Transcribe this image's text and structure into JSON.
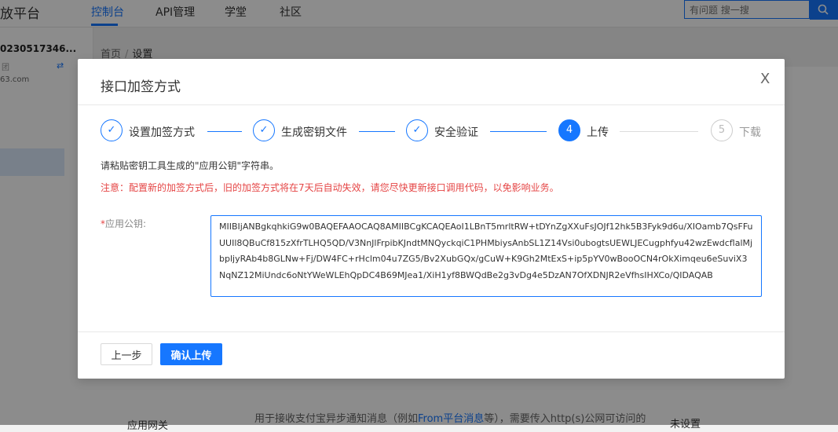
{
  "header": {
    "brand": "开放平台",
    "nav": [
      "控制台",
      "API管理",
      "学堂",
      "社区"
    ],
    "search_placeholder": "有问题 搜一搜"
  },
  "sidebar": {
    "account_id": "0230517346...",
    "account_tag": "团",
    "switch_icon": "⇄",
    "email": "63.com"
  },
  "breadcrumb": {
    "home": "首页",
    "separator": "/",
    "current": "设置"
  },
  "bg_row": {
    "label": "应用网关",
    "desc_prefix": "用于接收支付宝异步通知消息（例如",
    "desc_link": "From平台消息",
    "desc_suffix": "等），需要传入http(s)公网可访问的",
    "status": "未设置"
  },
  "modal": {
    "title": "接口加签方式",
    "close": "X",
    "steps": [
      {
        "label": "设置加签方式",
        "state": "done",
        "marker": "✓"
      },
      {
        "label": "生成密钥文件",
        "state": "done",
        "marker": "✓"
      },
      {
        "label": "安全验证",
        "state": "done",
        "marker": "✓"
      },
      {
        "label": "上传",
        "state": "active",
        "marker": "4"
      },
      {
        "label": "下载",
        "state": "todo",
        "marker": "5"
      }
    ],
    "hint": "请粘贴密钥工具生成的\"应用公钥\"字符串。",
    "warning": "注意：配置新的加签方式后，旧的加签方式将在7天后自动失效，请您尽快更新接口调用代码，以免影响业务。",
    "field_required_mark": "*",
    "field_label": "应用公钥:",
    "public_key": "MIIBIjANBgkqhkiG9w0BAQEFAAOCAQ8AMIIBCgKCAQEAoI1LBnT5mrltRW+tDYnZgXXuFsJOJf12hk5B3Fyk9d6u/XIOamb7QsFFuUUIl8QBuCf815zXfrTLHQ5QD/V3NnJlFrpibKJndtMNQyckqiC1PHMbiysAnbSL1Z14Vsi0ubogtsUEWLJECugphfyu42wzEwdcflalMjbpljyRAb4b8GLNw+Fj/DW4FC+rHclm04u7ZG5/Bv2XubGQx/gCuW+K9Gh2MtExS+ip5pYV0wBooOCN4rOkXimqeu6eSuviX3NqNZ12MiUndc6oNtYWeWLEhQpDC4B69MJea1/XiH1yf8BWQdBe2g3vDg4e5DzAN7OfXDNJR2eVfhsIHXCo/QIDAQAB",
    "btn_prev": "上一步",
    "btn_submit": "确认上传"
  },
  "colors": {
    "primary": "#1677ff",
    "danger": "#e54545"
  }
}
